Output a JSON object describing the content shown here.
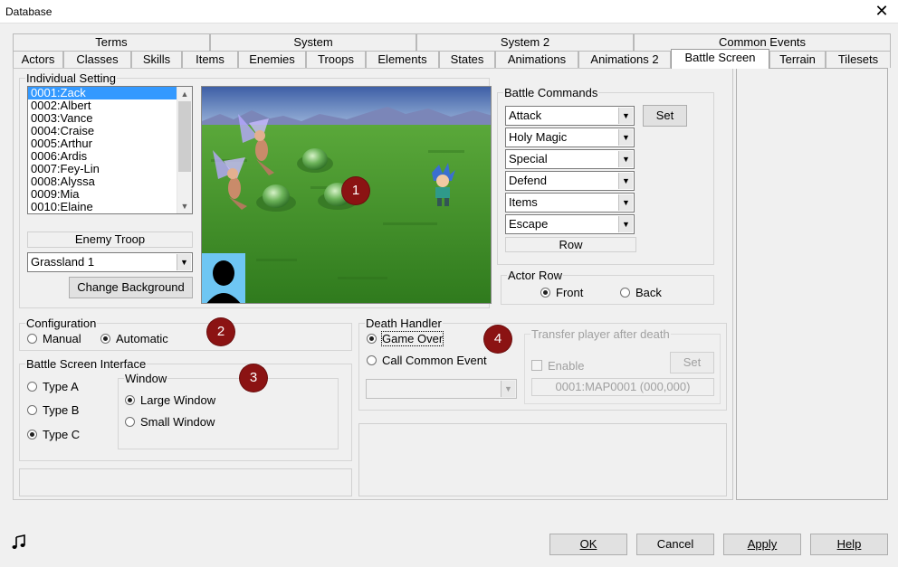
{
  "window": {
    "title": "Database",
    "close_glyph": "✕"
  },
  "tabs_row1": [
    "Terms",
    "System",
    "System 2",
    "Common Events"
  ],
  "tabs_row2": [
    "Actors",
    "Classes",
    "Skills",
    "Items",
    "Enemies",
    "Troops",
    "Elements",
    "States",
    "Animations",
    "Animations 2",
    "Battle Screen",
    "Terrain",
    "Tilesets"
  ],
  "active_tab": "Battle Screen",
  "individual_setting": {
    "label": "Individual Setting",
    "actors": [
      "0001:Zack",
      "0002:Albert",
      "0003:Vance",
      "0004:Craise",
      "0005:Arthur",
      "0006:Ardis",
      "0007:Fey-Lin",
      "0008:Alyssa",
      "0009:Mia",
      "0010:Elaine"
    ],
    "selected_index": 0,
    "enemy_troop_label": "Enemy Troop",
    "enemy_troop_value": "Grassland 1",
    "change_background_label": "Change Background"
  },
  "battle_commands": {
    "label": "Battle Commands",
    "commands": [
      "Attack",
      "Holy Magic",
      "Special",
      "Defend",
      "Items",
      "Escape"
    ],
    "set_label": "Set",
    "row_label": "Row"
  },
  "actor_row": {
    "label": "Actor Row",
    "options": [
      "Front",
      "Back"
    ],
    "selected": "Front"
  },
  "configuration": {
    "label": "Configuration",
    "options": [
      "Manual",
      "Automatic"
    ],
    "selected": "Automatic"
  },
  "battle_screen_interface": {
    "label": "Battle Screen Interface",
    "types": [
      "Type A",
      "Type B",
      "Type C"
    ],
    "selected_type": "Type C",
    "window_label": "Window",
    "window_options": [
      "Large Window",
      "Small Window"
    ],
    "selected_window": "Large Window"
  },
  "death_handler": {
    "label": "Death Handler",
    "options": [
      "Game Over",
      "Call Common Event"
    ],
    "selected": "Game Over",
    "common_event_value": "",
    "transfer": {
      "label": "Transfer player after death",
      "enable_label": "Enable",
      "set_label": "Set",
      "map_value": "0001:MAP0001 (000,000)"
    }
  },
  "badges": [
    "1",
    "2",
    "3",
    "4"
  ],
  "footer": {
    "ok": "OK",
    "cancel": "Cancel",
    "apply": "Apply",
    "help": "Help",
    "music_icon": "music-note-icon"
  },
  "colors": {
    "selection": "#3399ff",
    "badge": "#8b1313",
    "sky": "#6f93c8",
    "grass": "#3f8a24"
  }
}
